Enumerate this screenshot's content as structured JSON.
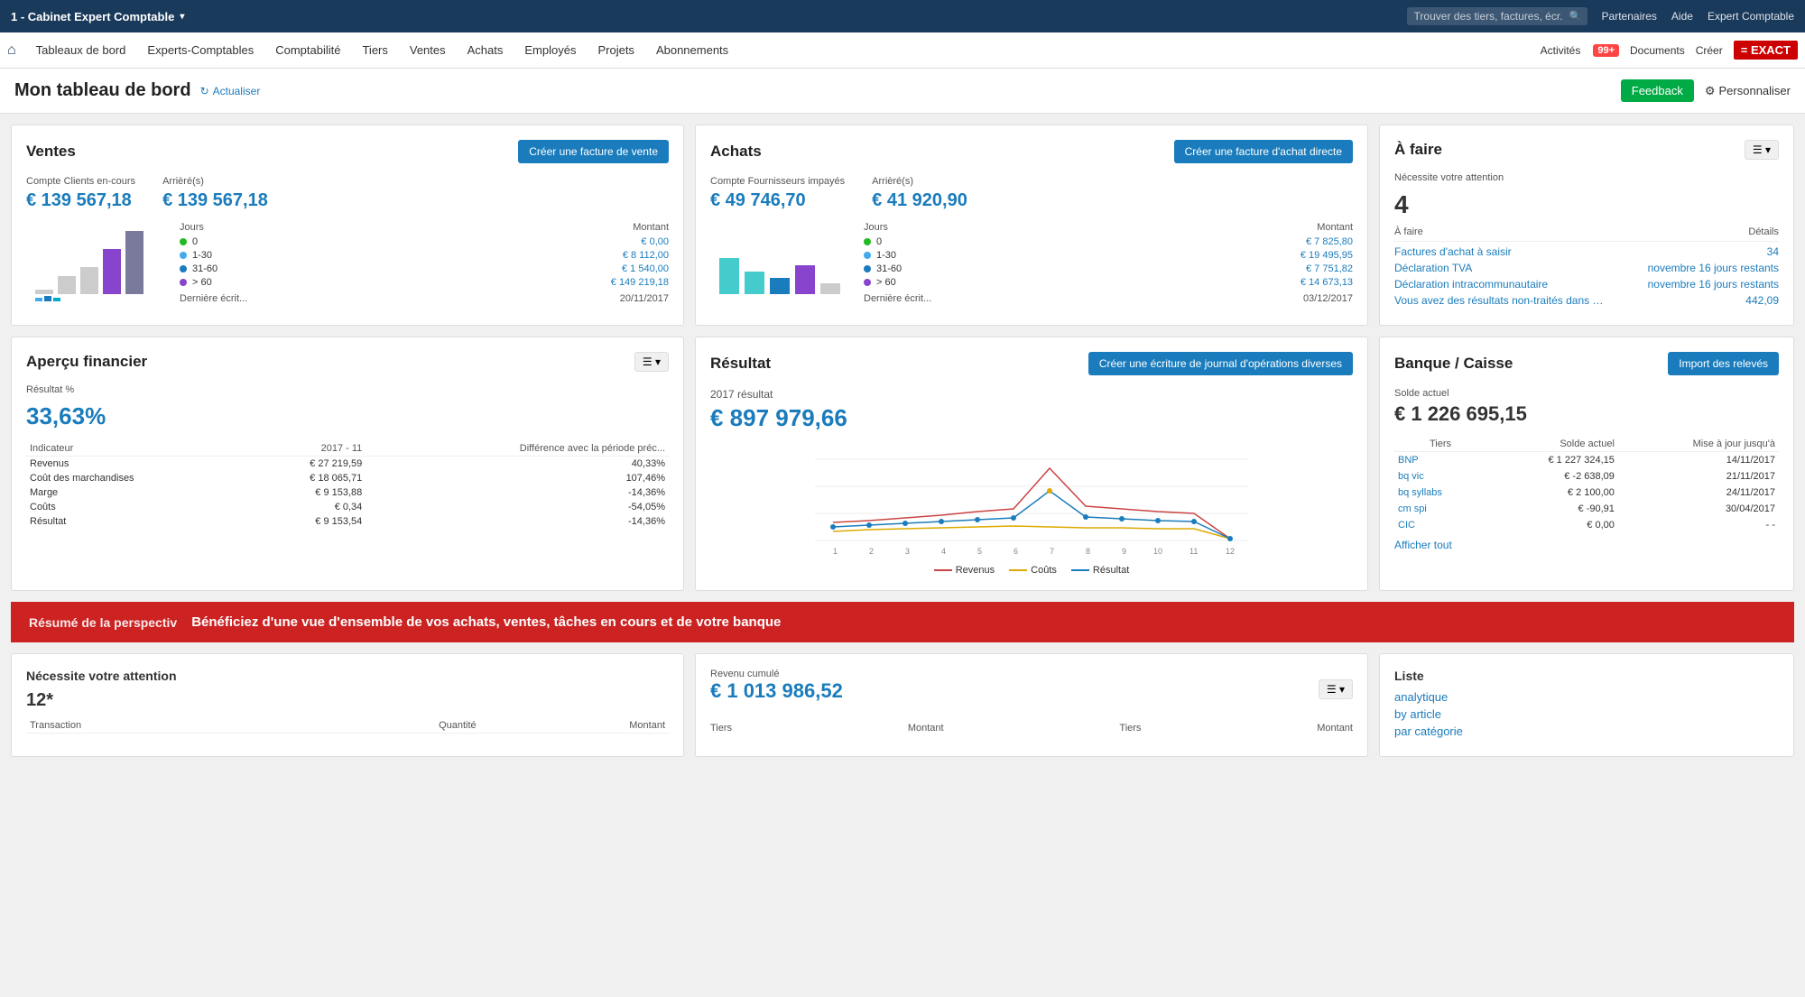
{
  "topNav": {
    "company": "1 - Cabinet Expert Comptable",
    "searchPlaceholder": "Trouver des tiers, factures, écr...",
    "partenaires": "Partenaires",
    "aide": "Aide",
    "expertComptable": "Expert Comptable"
  },
  "menuBar": {
    "items": [
      "Tableaux de bord",
      "Experts-Comptables",
      "Comptabilité",
      "Tiers",
      "Ventes",
      "Achats",
      "Employés",
      "Projets",
      "Abonnements"
    ],
    "activites": "Activités",
    "activitesBadge": "99+",
    "documents": "Documents",
    "creer": "Créer",
    "exactLogo": "= EXACT"
  },
  "pageHeader": {
    "title": "Mon tableau de bord",
    "actualiser": "Actualiser",
    "feedback": "Feedback",
    "personaliser": "Personnaliser"
  },
  "ventes": {
    "title": "Ventes",
    "btnLabel": "Créer une facture de vente",
    "compteLabel": "Compte Clients en-cours",
    "compteValue": "€ 139 567,18",
    "arriereLabel": "Arrièré(s)",
    "arriereValue": "€ 139 567,18",
    "cols": [
      "Jours",
      "Montant"
    ],
    "rows": [
      {
        "color": "#22bb22",
        "label": "0",
        "amount": "€ 0,00"
      },
      {
        "color": "#44aaee",
        "label": "1-30",
        "amount": "€ 8 112,00"
      },
      {
        "color": "#1a7cbc",
        "label": "31-60",
        "amount": "€ 1 540,00"
      },
      {
        "color": "#8844cc",
        "label": "> 60",
        "amount": "€ 149 219,18"
      }
    ],
    "derniereLabel": "Dernière écrit...",
    "derniereDate": "20/11/2017"
  },
  "achats": {
    "title": "Achats",
    "btnLabel": "Créer une facture d'achat directe",
    "compteLabel": "Compte Fournisseurs impayés",
    "compteValue": "€ 49 746,70",
    "arriereLabel": "Arrièré(s)",
    "arriereValue": "€ 41 920,90",
    "cols": [
      "Jours",
      "Montant"
    ],
    "rows": [
      {
        "color": "#22bb22",
        "label": "0",
        "amount": "€ 7 825,80"
      },
      {
        "color": "#44aaee",
        "label": "1-30",
        "amount": "€ 19 495,95"
      },
      {
        "color": "#1a7cbc",
        "label": "31-60",
        "amount": "€ 7 751,82"
      },
      {
        "color": "#8844cc",
        "label": "> 60",
        "amount": "€ 14 673,13"
      }
    ],
    "derniereLabel": "Dernière écrit...",
    "derniereDate": "03/12/2017"
  },
  "afaire": {
    "title": "À faire",
    "necessite": "Nécessite votre attention",
    "number": "4",
    "cols": [
      "À faire",
      "Détails"
    ],
    "items": [
      {
        "label": "Factures d'achat à saisir",
        "value": "34"
      },
      {
        "label": "Déclaration TVA",
        "value": "novembre 16 jours restants"
      },
      {
        "label": "Déclaration intracommunautaire",
        "value": "novembre 16 jours restants"
      },
      {
        "label": "Vous avez des résultats non-traités dans …",
        "value": "442,09"
      }
    ]
  },
  "apercu": {
    "title": "Aperçu financier",
    "resultatLabel": "Résultat %",
    "resultatValue": "33,63%",
    "colHeaders": [
      "Indicateur",
      "2017 - 11",
      "Différence avec la période préc..."
    ],
    "rows": [
      {
        "label": "Revenus",
        "val1": "€ 27 219,59",
        "val2": "40,33%"
      },
      {
        "label": "Coût des marchandises",
        "val1": "€ 18 065,71",
        "val2": "107,46%"
      },
      {
        "label": "Marge",
        "val1": "€ 9 153,88",
        "val2": "-14,36%"
      },
      {
        "label": "Coûts",
        "val1": "€ 0,34",
        "val2": "-54,05%"
      },
      {
        "label": "Résultat",
        "val1": "€ 9 153,54",
        "val2": "-14,36%"
      }
    ]
  },
  "resultat": {
    "title": "Résultat",
    "btnLabel": "Créer une écriture de journal d'opérations diverses",
    "yearLabel": "2017 résultat",
    "value": "€ 897 979,66",
    "chartLabels": [
      "1",
      "2",
      "3",
      "4",
      "5",
      "6",
      "7",
      "8",
      "9",
      "10",
      "11",
      "12"
    ],
    "legend": [
      {
        "label": "Revenus",
        "color": "#cc4444"
      },
      {
        "label": "Coûts",
        "color": "#ddaa00"
      },
      {
        "label": "Résultat",
        "color": "#1a7cbc"
      }
    ]
  },
  "banque": {
    "title": "Banque / Caisse",
    "btnLabel": "Import des relevés",
    "soldeLabel": "Solde actuel",
    "soldeValue": "€ 1 226 695,15",
    "colHeaders": [
      "Tiers",
      "Solde actuel",
      "Mise à jour jusqu'à"
    ],
    "rows": [
      {
        "tiers": "BNP",
        "solde": "€ 1 227 324,15",
        "date": "14/11/2017"
      },
      {
        "tiers": "bq vic",
        "solde": "€ -2 638,09",
        "date": "21/11/2017"
      },
      {
        "tiers": "bq syllabs",
        "solde": "€ 2 100,00",
        "date": "24/11/2017"
      },
      {
        "tiers": "cm spi",
        "solde": "€ -90,91",
        "date": "30/04/2017"
      },
      {
        "tiers": "CIC",
        "solde": "€ 0,00",
        "date": "- -"
      }
    ],
    "afficherTout": "Afficher tout"
  },
  "promoBanner": {
    "labelLeft": "Résumé de la perspectiv",
    "text": "Bénéficiez d'une vue d'ensemble de vos achats, ventes, tâches en cours et de votre banque"
  },
  "bottomLeft": {
    "necessite": "Nécessite votre attention",
    "number": "12*",
    "colHeaders": [
      "Transaction",
      "Quantité",
      "Montant"
    ]
  },
  "bottomMiddle": {
    "revenuLabel": "Revenu cumulé",
    "revenuValue": "€ 1 013 986,52",
    "colHeaders": [
      "Tiers",
      "Montant",
      "Tiers",
      "Montant"
    ]
  },
  "bottomRight": {
    "title": "Liste",
    "links": [
      "analytique",
      "by article",
      "par catégorie"
    ]
  }
}
